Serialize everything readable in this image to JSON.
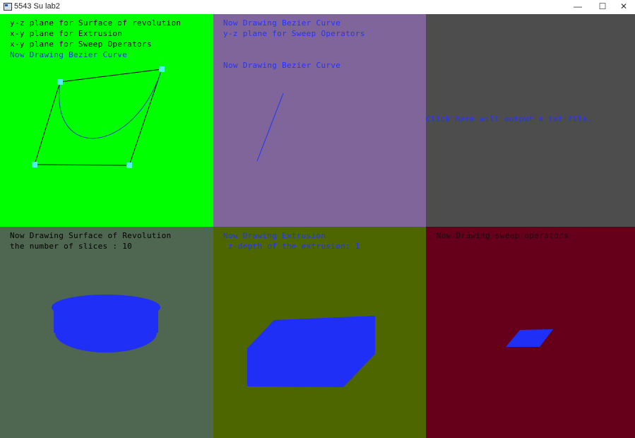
{
  "window": {
    "title": "5543 Su lab2",
    "minimize": "—",
    "maximize": "☐",
    "close": "✕"
  },
  "viewports": {
    "bezier_xy": {
      "background": "#00ff00",
      "lines": [
        "y-z plane for Surface of revolution",
        "x-y plane for Extrusion",
        "x-y plane for Sweep Operators",
        "Now Drawing Bezier Curve"
      ],
      "line_colors": [
        "#000000",
        "#000000",
        "#000000",
        "#1f2fe0"
      ],
      "curve_color": "#1f3cc8",
      "control_color": "#4ff0ee"
    },
    "bezier_yz": {
      "background": "#80659a",
      "lines": [
        "Now Drawing Bezier Curve",
        "y-z plane for Sweep Operators"
      ],
      "lines2": "Now Drawing Bezier Curve",
      "text_color": "#2233ff",
      "curve_color": "#2233ff"
    },
    "output": {
      "background": "#4d4d4d",
      "text": "Click here will output a txt file.",
      "text_color": "#2233ff"
    },
    "surface_revolution": {
      "background": "#4f6650",
      "lines": [
        "Now Drawing Surface of Revolution",
        "the number of slices : 10"
      ],
      "text_color": "#000000",
      "shape_color": "#1f2ff5"
    },
    "extrusion": {
      "background": "#4d6600",
      "lines": [
        "Now Drawing Extrusion",
        " z-depth of the extrusion: 1"
      ],
      "text_color": "#2233ff",
      "shape_color": "#1f2ff5"
    },
    "sweep": {
      "background": "#66001a",
      "text": " Now Drawing sweep operators",
      "text_color": "#111111",
      "shape_color": "#1f2ff5"
    }
  }
}
